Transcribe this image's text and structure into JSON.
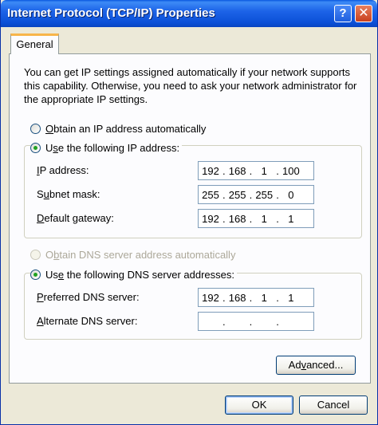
{
  "window": {
    "title": "Internet Protocol (TCP/IP) Properties",
    "help_glyph": "?",
    "close_glyph": "✕"
  },
  "tabs": [
    {
      "label": "General"
    }
  ],
  "description": "You can get IP settings assigned automatically if your network supports this capability. Otherwise, you need to ask your network administrator for the appropriate IP settings.",
  "ip_section": {
    "obtain_auto": {
      "mnemonic": "O",
      "rest": "btain an IP address automatically",
      "selected": false
    },
    "use_following": {
      "pre": "U",
      "mnemonic": "s",
      "rest": "e the following IP address:",
      "selected": true
    },
    "fields": [
      {
        "mnemonic": "I",
        "rest": "P address:",
        "octets": [
          "192",
          "168",
          "1",
          "100"
        ]
      },
      {
        "pre": "S",
        "mnemonic": "u",
        "rest": "bnet mask:",
        "octets": [
          "255",
          "255",
          "255",
          "0"
        ]
      },
      {
        "mnemonic": "D",
        "rest": "efault gateway:",
        "octets": [
          "192",
          "168",
          "1",
          "1"
        ]
      }
    ]
  },
  "dns_section": {
    "obtain_auto": {
      "pre": "O",
      "mnemonic": "b",
      "rest": "tain DNS server address automatically",
      "selected": false,
      "disabled": true
    },
    "use_following": {
      "pre": "Us",
      "mnemonic": "e",
      "rest": " the following DNS server addresses:",
      "selected": true
    },
    "fields": [
      {
        "mnemonic": "P",
        "rest": "referred DNS server:",
        "octets": [
          "192",
          "168",
          "1",
          "1"
        ]
      },
      {
        "mnemonic": "A",
        "rest": "lternate DNS server:",
        "octets": [
          "",
          "",
          "",
          ""
        ]
      }
    ]
  },
  "buttons": {
    "advanced": {
      "pre": "Ad",
      "mnemonic": "v",
      "rest": "anced..."
    },
    "ok": "OK",
    "cancel": "Cancel"
  },
  "colors": {
    "title_bar": "#0b4fd6",
    "dialog_bg": "#ece9d8",
    "panel_bg": "#fcfcfe",
    "tab_highlight": "#f7b54a"
  }
}
